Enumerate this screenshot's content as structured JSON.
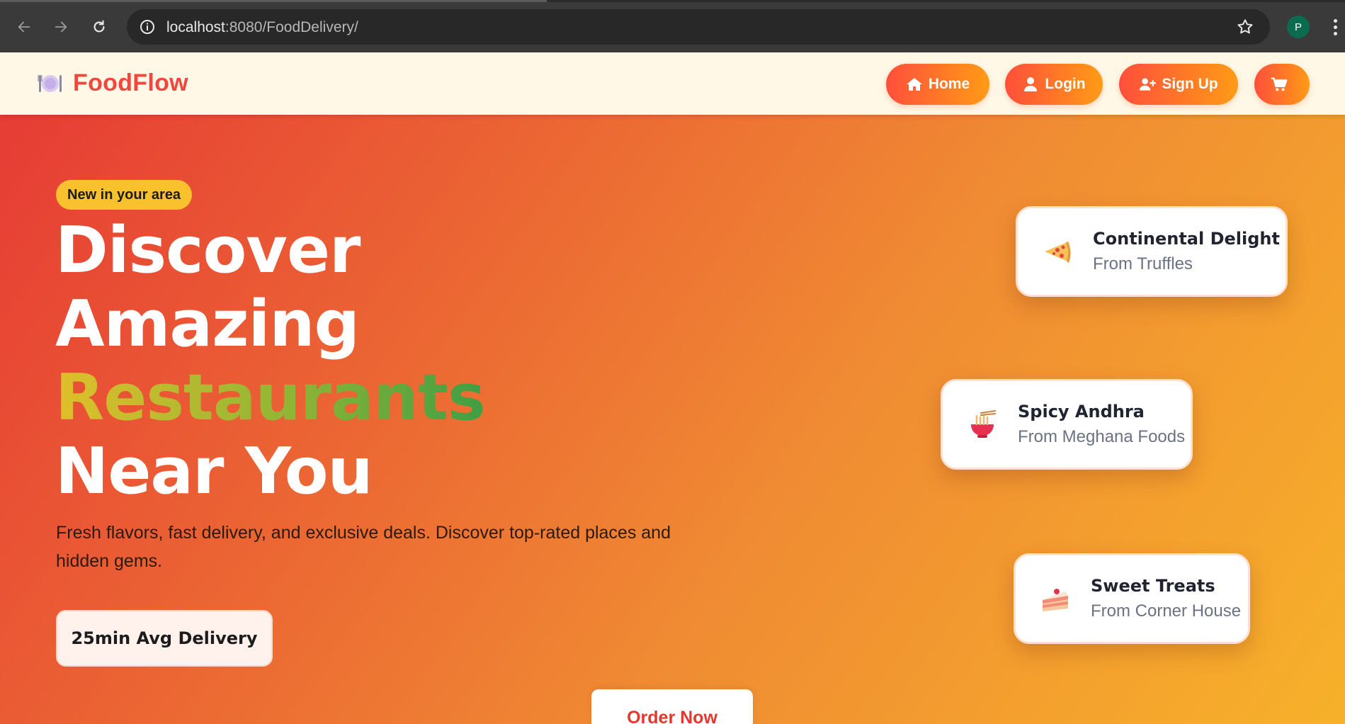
{
  "browser": {
    "url_host": "localhost",
    "url_rest": ":8080/FoodDelivery/",
    "profile_initial": "P"
  },
  "header": {
    "brand": "FoodFlow",
    "nav": [
      {
        "label": "Home",
        "icon": "home-icon"
      },
      {
        "label": "Login",
        "icon": "user-icon"
      },
      {
        "label": "Sign Up",
        "icon": "user-plus-icon"
      },
      {
        "label": "",
        "icon": "cart-icon"
      }
    ]
  },
  "hero": {
    "badge": "New in your area",
    "headline": [
      "Discover",
      "Amazing",
      "Restaurants",
      "Near You"
    ],
    "subtext": "Fresh flavors, fast delivery, and exclusive deals. Discover top-rated places and hidden gems.",
    "stat": "25min Avg Delivery",
    "cta": "Order Now"
  },
  "cards": [
    {
      "title": "Continental Delight",
      "from": "From Truffles",
      "icon": "pizza-icon"
    },
    {
      "title": "Spicy Andhra",
      "from": "From Meghana Foods",
      "icon": "noodle-bowl-icon"
    },
    {
      "title": "Sweet Treats",
      "from": "From Corner House",
      "icon": "cake-icon"
    }
  ],
  "colors": {
    "brand": "#f0483e",
    "gradient_start": "#ff4f3b",
    "gradient_end": "#ff9b16",
    "badge": "#f8c12d"
  }
}
